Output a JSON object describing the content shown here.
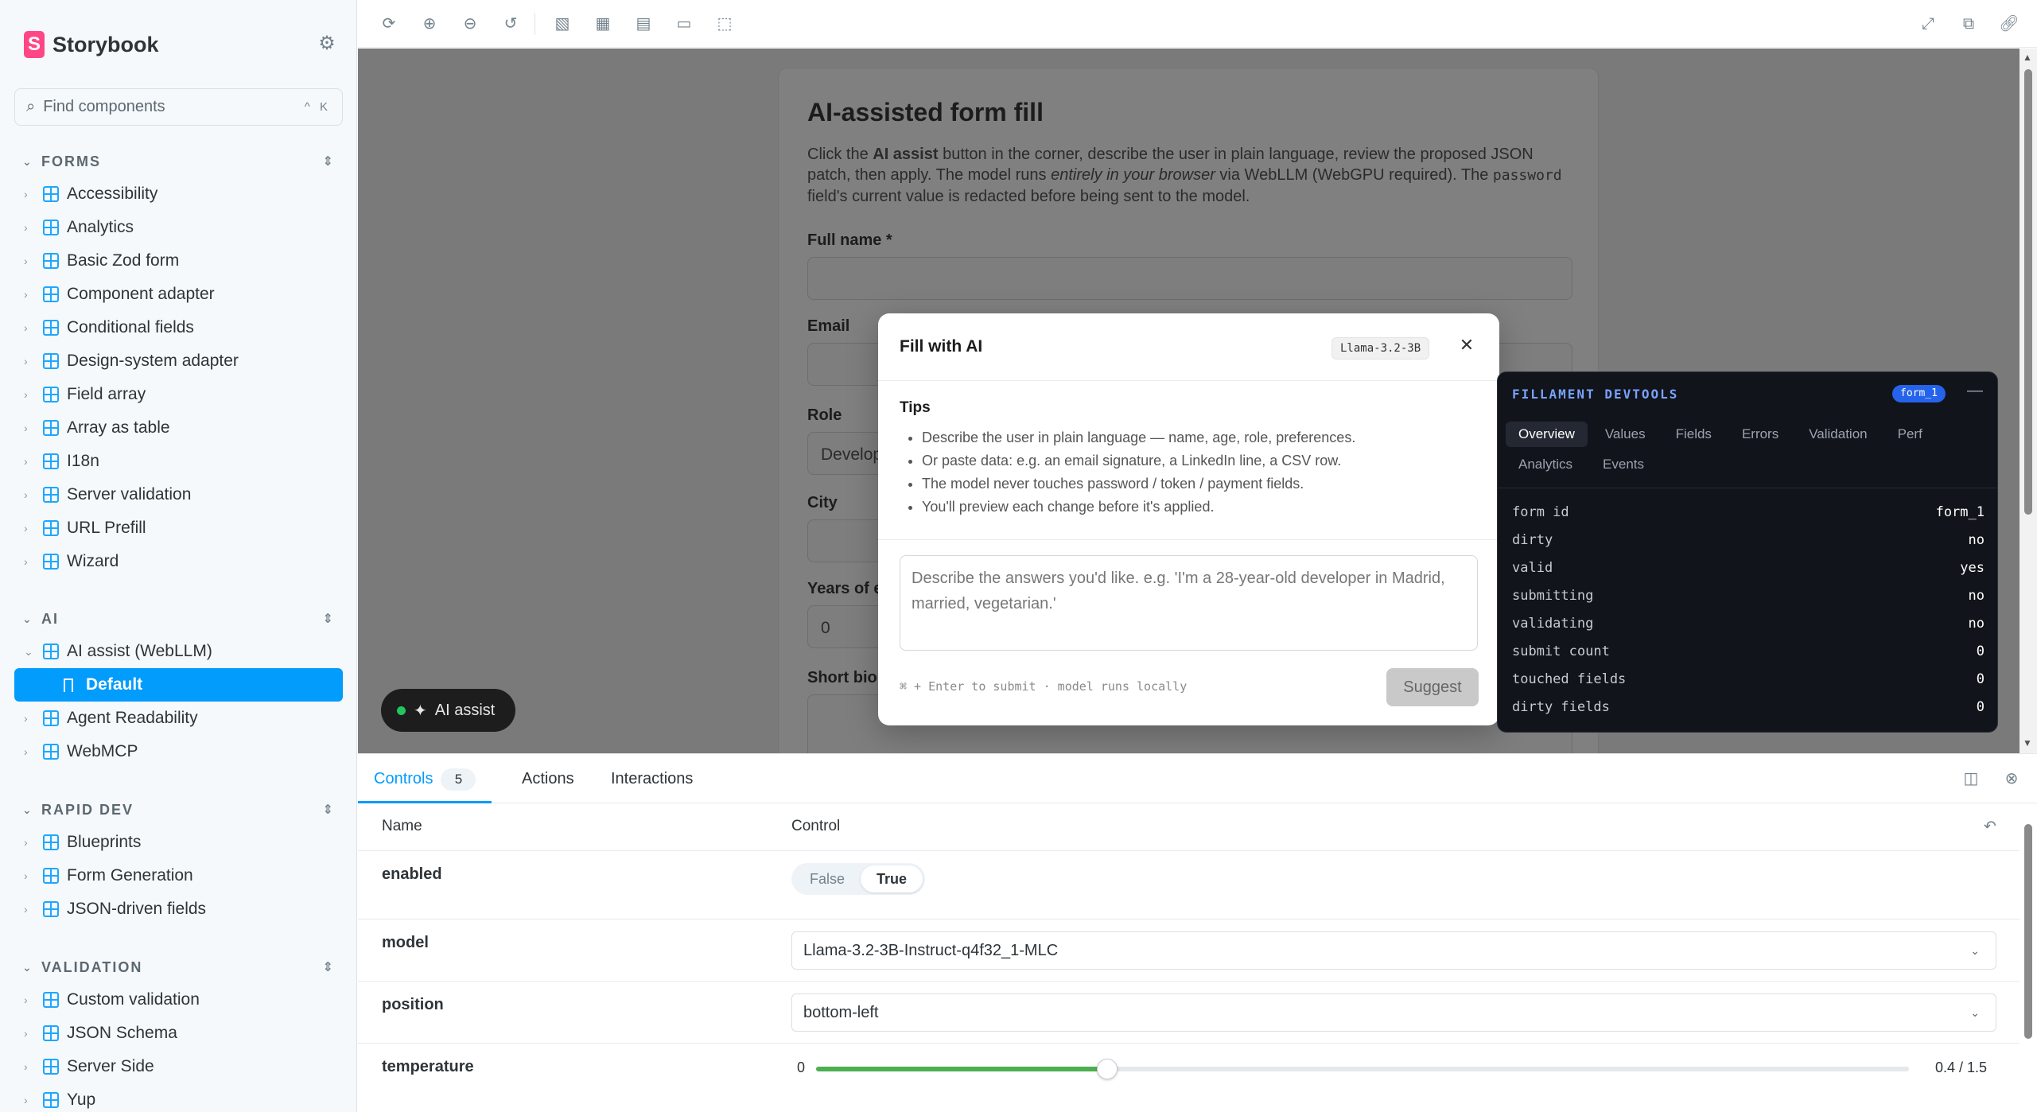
{
  "sidebar": {
    "brand": "Storybook",
    "search_placeholder": "Find components",
    "search_shortcut": "^ K",
    "groups": [
      {
        "title": "FORMS",
        "items": [
          "Accessibility",
          "Analytics",
          "Basic Zod form",
          "Component adapter",
          "Conditional fields",
          "Design-system adapter",
          "Field array",
          "Array as table",
          "I18n",
          "Server validation",
          "URL Prefill",
          "Wizard"
        ]
      },
      {
        "title": "AI",
        "items": [
          "AI assist (WebLLM)",
          "Default",
          "Agent Readability",
          "WebMCP"
        ]
      },
      {
        "title": "RAPID DEV",
        "items": [
          "Blueprints",
          "Form Generation",
          "JSON-driven fields"
        ]
      },
      {
        "title": "VALIDATION",
        "items": [
          "Custom validation",
          "JSON Schema",
          "Server Side",
          "Yup"
        ]
      }
    ],
    "selected_story": "Default"
  },
  "toolbar": {
    "icons": [
      "reload-icon",
      "zoom-in-icon",
      "zoom-out-icon",
      "zoom-reset-icon",
      "background-icon",
      "grid-icon",
      "measure-icon",
      "outline-icon",
      "viewport-icon"
    ],
    "right_icons": [
      "fullscreen-icon",
      "open-new-tab-icon",
      "copy-link-icon"
    ]
  },
  "form": {
    "title": "AI-assisted form fill",
    "desc_1": "Click the ",
    "desc_bold": "AI assist",
    "desc_2": " button in the corner, describe the user in plain language, review the proposed JSON patch, then apply. The model runs ",
    "desc_em": "entirely in your browser",
    "desc_3": " via WebLLM (WebGPU required). The ",
    "desc_code": "password",
    "desc_4": " field's current value is redacted before being sent to the model.",
    "labels": {
      "full_name": "Full name *",
      "email": "Email",
      "role": "Role",
      "city": "City",
      "years": "Years of ex",
      "bio": "Short bio"
    },
    "role_value": "Develop",
    "years_value": "0",
    "ai_button": "AI assist"
  },
  "modal": {
    "title": "Fill with AI",
    "model_badge": "Llama-3.2-3B",
    "tips_title": "Tips",
    "tips": [
      "Describe the user in plain language — name, age, role, preferences.",
      "Or paste data: e.g. an email signature, a LinkedIn line, a CSV row.",
      "The model never touches password / token / payment fields.",
      "You'll preview each change before it's applied."
    ],
    "textarea_placeholder": "Describe the answers you'd like. e.g. 'I'm a 28-year-old developer in Madrid, married, vegetarian.'",
    "hint": "⌘ + Enter to submit · model runs locally",
    "suggest": "Suggest"
  },
  "devtools": {
    "title": "FILLAMENT DEVTOOLS",
    "badge": "form_1",
    "tabs": [
      "Overview",
      "Values",
      "Fields",
      "Errors",
      "Validation",
      "Perf",
      "Analytics",
      "Events"
    ],
    "active_tab": "Overview",
    "rows": [
      {
        "k": "form id",
        "v": "form_1"
      },
      {
        "k": "dirty",
        "v": "no"
      },
      {
        "k": "valid",
        "v": "yes"
      },
      {
        "k": "submitting",
        "v": "no"
      },
      {
        "k": "validating",
        "v": "no"
      },
      {
        "k": "submit count",
        "v": "0"
      },
      {
        "k": "touched fields",
        "v": "0"
      },
      {
        "k": "dirty fields",
        "v": "0"
      }
    ]
  },
  "addons": {
    "tabs": [
      "Controls",
      "Actions",
      "Interactions"
    ],
    "controls_count": "5",
    "col_name": "Name",
    "col_control": "Control",
    "rows": {
      "enabled": {
        "name": "enabled",
        "false_label": "False",
        "true_label": "True"
      },
      "model": {
        "name": "model",
        "value": "Llama-3.2-3B-Instruct-q4f32_1-MLC"
      },
      "position": {
        "name": "position",
        "value": "bottom-left"
      },
      "temperature": {
        "name": "temperature",
        "min": "0",
        "value": 0.4,
        "max": 1.5,
        "readout": "0.4 / 1.5"
      }
    }
  }
}
